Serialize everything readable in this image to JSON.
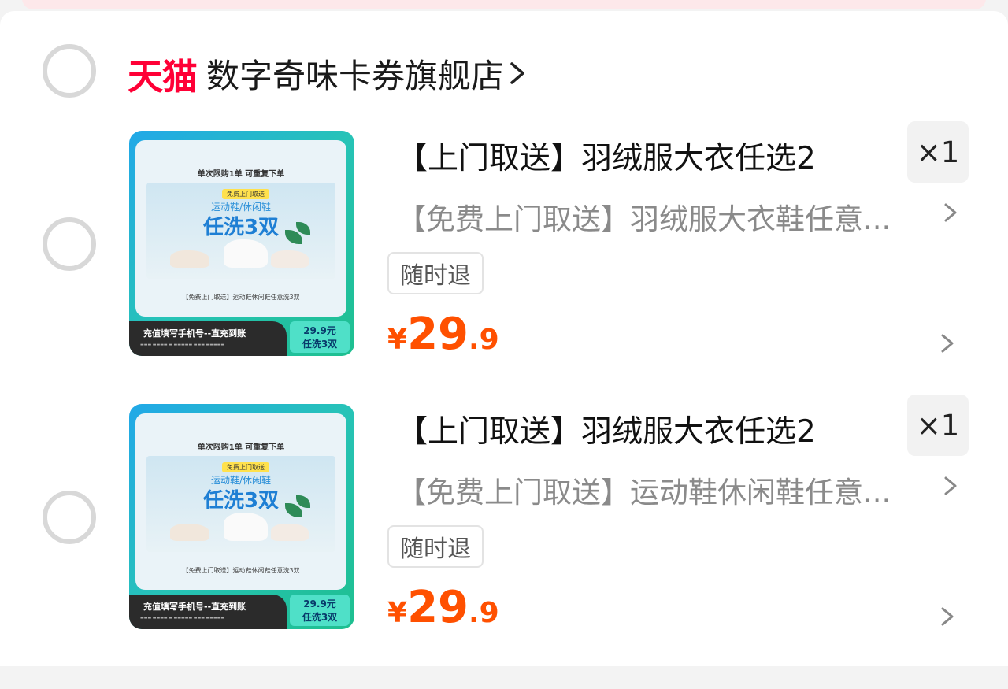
{
  "store": {
    "logo_text": "天猫",
    "name": "数字奇味卡券旗舰店"
  },
  "colors": {
    "brand_red": "#ff0036",
    "price_orange": "#ff5000"
  },
  "items": [
    {
      "title": "【上门取送】羽绒服大衣任选2",
      "quantity": "×1",
      "subtitle": "【免费上门取送】羽绒服大衣鞋任意...",
      "tag": "随时退",
      "price": {
        "symbol": "¥",
        "integer": "29",
        "decimal": ".9"
      },
      "thumbnail": {
        "top_text": "单次限购1单  可重复下单",
        "badge": "免费上门取送",
        "sub": "运动鞋/休闲鞋",
        "big": "任洗3双",
        "caption": "【免费上门取送】运动鞋休闲鞋任意洗3双",
        "bar_text": "充值填写手机号--直充到账",
        "price_line1": "29.9元",
        "price_line2": "任洗3双"
      }
    },
    {
      "title": "【上门取送】羽绒服大衣任选2",
      "quantity": "×1",
      "subtitle": "【免费上门取送】运动鞋休闲鞋任意...",
      "tag": "随时退",
      "price": {
        "symbol": "¥",
        "integer": "29",
        "decimal": ".9"
      },
      "thumbnail": {
        "top_text": "单次限购1单  可重复下单",
        "badge": "免费上门取送",
        "sub": "运动鞋/休闲鞋",
        "big": "任洗3双",
        "caption": "【免费上门取送】运动鞋休闲鞋任意洗3双",
        "bar_text": "充值填写手机号--直充到账",
        "price_line1": "29.9元",
        "price_line2": "任洗3双"
      }
    }
  ]
}
